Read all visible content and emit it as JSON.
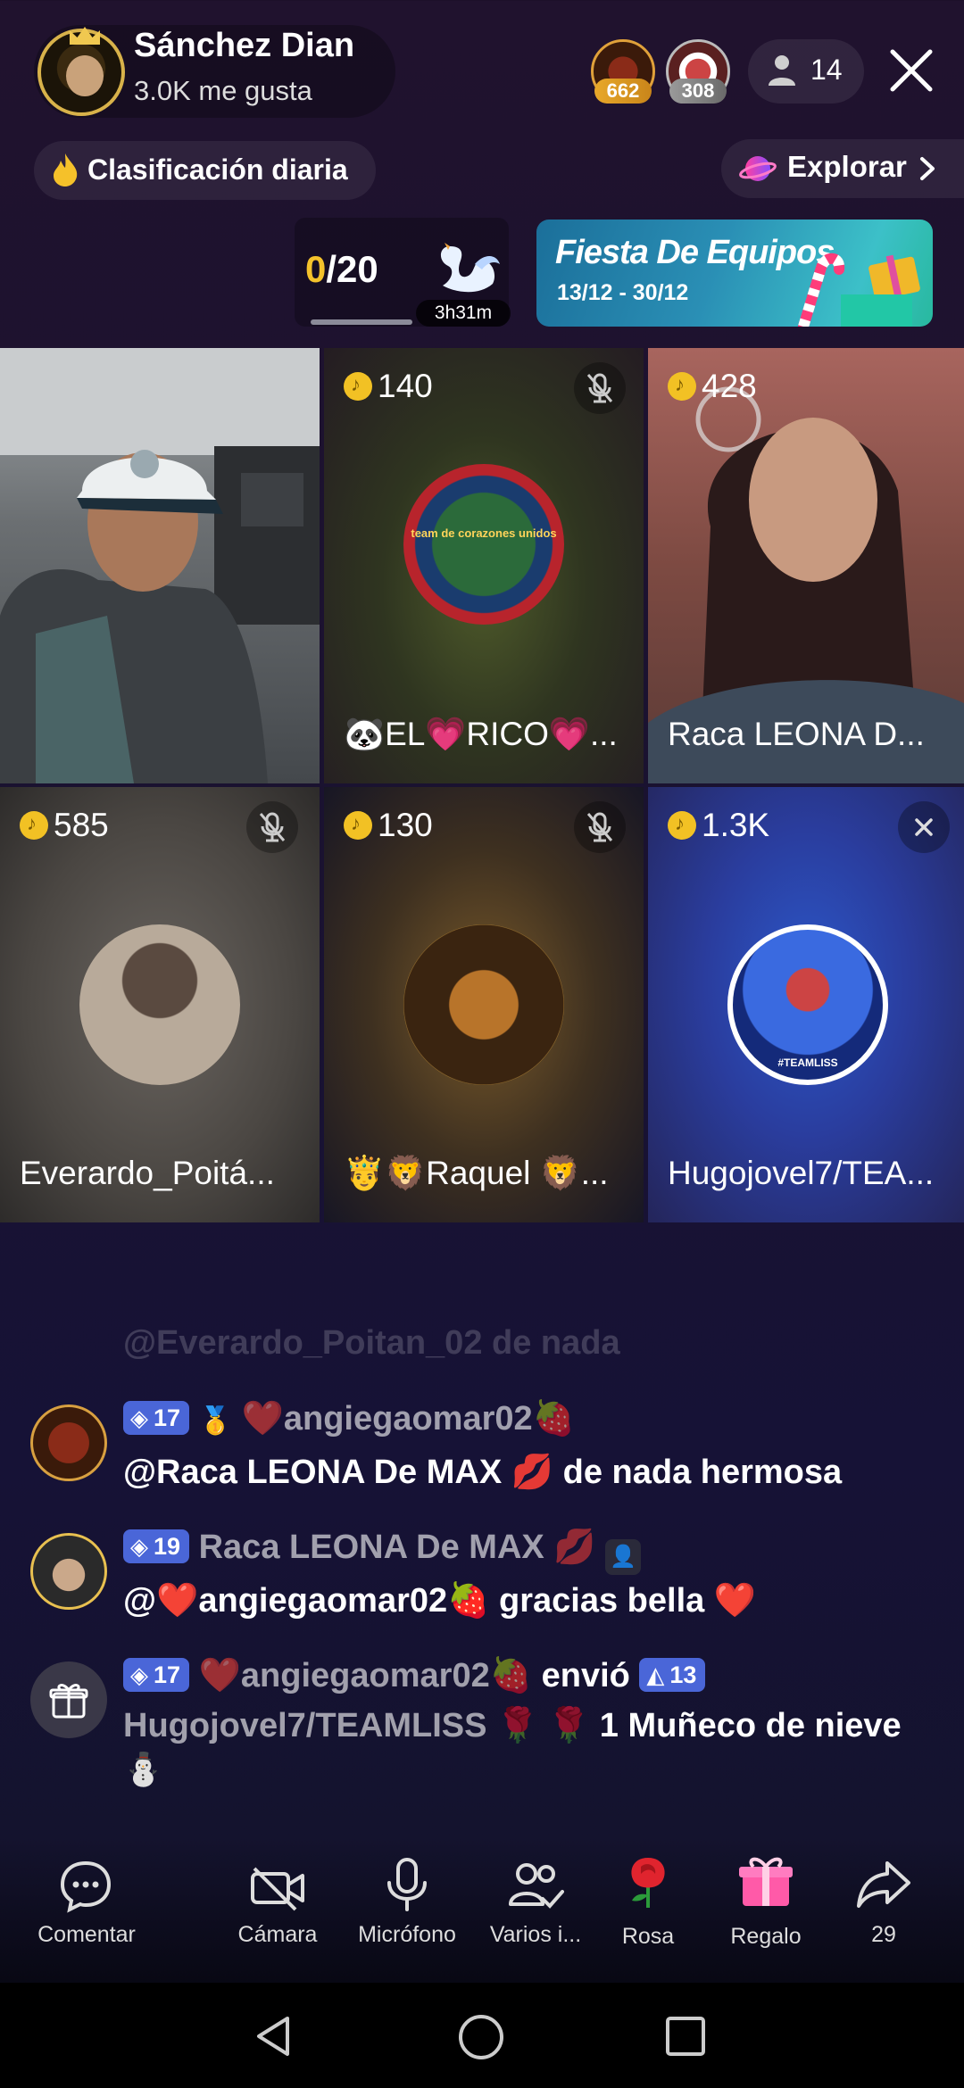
{
  "header": {
    "host_name": "Sánchez Dian",
    "host_likes": "3.0K me gusta",
    "top_viewers": [
      {
        "badge": "662"
      },
      {
        "badge": "308"
      }
    ],
    "viewer_count": "14",
    "ranking_label": "Clasificación diaria",
    "explore_label": "Explorar"
  },
  "goal": {
    "current": "0",
    "total": "/20",
    "timer": "3h31m"
  },
  "event_banner": {
    "title": "Fiesta De Equipos",
    "dates": "13/12 - 30/12"
  },
  "grid": [
    {
      "score": "",
      "name": "",
      "muted": false
    },
    {
      "score": "140",
      "name": "🐼EL💗RICO💗...",
      "muted": true,
      "avatar_text": "team de corazones unidos"
    },
    {
      "score": "428",
      "name": "Raca LEONA D...",
      "muted": false
    },
    {
      "score": "585",
      "name": "Everardo_Poitá...",
      "muted": true
    },
    {
      "score": "130",
      "name": "🤴🦁Raquel 🦁...",
      "muted": true
    },
    {
      "score": "1.3K",
      "name": "Hugojovel7/TEA...",
      "muted": false,
      "close": true,
      "avatar_text": "#TEAMLISS"
    }
  ],
  "chat": {
    "faded_line": "@Everardo_Poitan_02 de nada",
    "messages": [
      {
        "level": "17",
        "user": "❤️angiegaomar02🍓",
        "text": "@Raca LEONA De MAX 💋 de nada hermosa"
      },
      {
        "level": "19",
        "user": "Raca LEONA De MAX 💋",
        "text": "@❤️angiegaomar02🍓 gracias  bella ❤️"
      },
      {
        "level": "17",
        "user": "❤️angiegaomar02🍓",
        "sent": "envió",
        "sub_level": "13",
        "line2_user": "Hugojovel7/TEAMLISS 🌹 🌹",
        "gift": "1 Muñeco de nieve",
        "gift_icon": "⛄"
      }
    ]
  },
  "toolbar": {
    "items": [
      {
        "label": "Comentar",
        "icon": "comment-icon"
      },
      {
        "label": "Cámara",
        "icon": "camera-off-icon"
      },
      {
        "label": "Micrófono",
        "icon": "microphone-icon"
      },
      {
        "label": "Varios i...",
        "icon": "multi-guest-icon"
      },
      {
        "label": "Rosa",
        "icon": "rose-icon"
      },
      {
        "label": "Regalo",
        "icon": "gift-icon"
      },
      {
        "label": "29",
        "icon": "share-icon"
      }
    ]
  },
  "colors": {
    "accent_gold": "#f2c124",
    "level_badge": "#4a66d8",
    "background": "#1a1230"
  }
}
